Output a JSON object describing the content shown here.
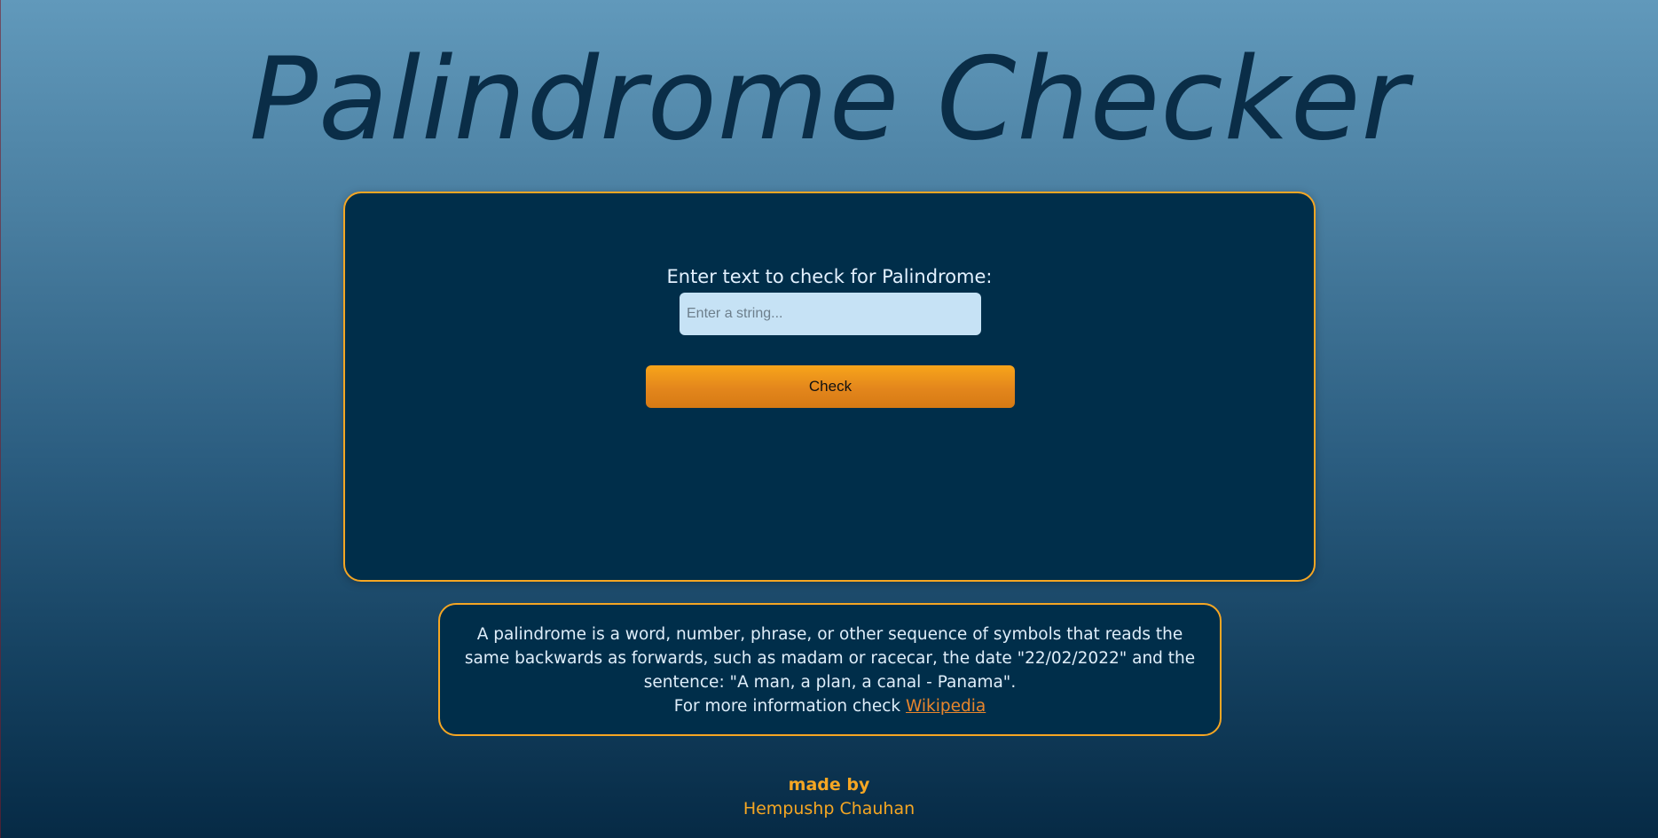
{
  "header": {
    "title": "Palindrome Checker"
  },
  "checker": {
    "label": "Enter text to check for Palindrome:",
    "input_placeholder": "Enter a string...",
    "input_value": "",
    "button_label": "Check"
  },
  "info": {
    "line1": "A palindrome is a word, number, phrase, or other sequence of symbols that reads the same backwards as forwards, such as madam or racecar, the date \"22/02/2022\" and the sentence: \"A man, a plan, a canal - Panama\".",
    "line2_prefix": "For more information check ",
    "link_label": "Wikipedia"
  },
  "footer": {
    "made_by": "made by",
    "author": "Hempushp Chauhan"
  },
  "colors": {
    "accent": "#f5a623",
    "card_bg": "#002e4a",
    "title": "#0a2d47",
    "link": "#e9862c"
  }
}
